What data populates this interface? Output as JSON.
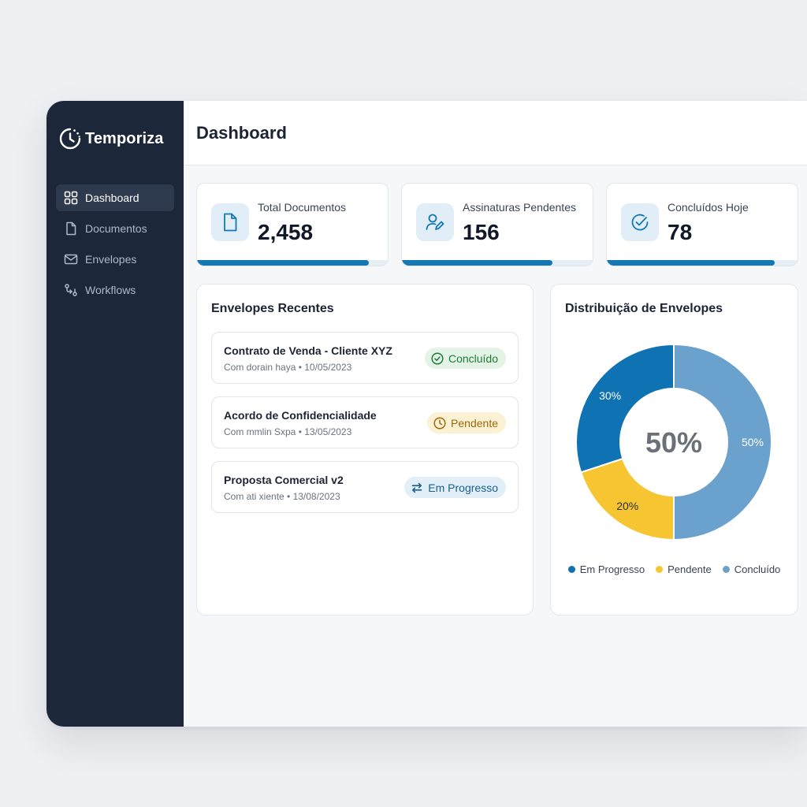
{
  "brand": {
    "name": "Temporiza"
  },
  "sidebar": {
    "items": [
      {
        "label": "Dashboard",
        "icon": "grid-icon",
        "active": true
      },
      {
        "label": "Documentos",
        "icon": "document-icon",
        "active": false
      },
      {
        "label": "Envelopes",
        "icon": "mail-icon",
        "active": false
      },
      {
        "label": "Workflows",
        "icon": "workflow-icon",
        "active": false
      }
    ]
  },
  "header": {
    "title": "Dashboard"
  },
  "stats": [
    {
      "label": "Total Documentos",
      "value": "2,458",
      "icon": "document-icon",
      "progress": 0.9
    },
    {
      "label": "Assinaturas Pendentes",
      "value": "156",
      "icon": "user-sign-icon",
      "progress": 0.79
    },
    {
      "label": "Concluídos Hoje",
      "value": "78",
      "icon": "check-circle-icon",
      "progress": 0.88
    }
  ],
  "recent": {
    "title": "Envelopes Recentes",
    "items": [
      {
        "name": "Contrato de Venda - Cliente XYZ",
        "meta": "Com dorain haya  •  10/05/2023",
        "status": "Concluído",
        "status_type": "done"
      },
      {
        "name": "Acordo de Confidencialidade",
        "meta": "Com mmlin Sxpa  •  13/05/2023",
        "status": "Pendente",
        "status_type": "pending"
      },
      {
        "name": "Proposta Comercial v2",
        "meta": "Com ati xiente  •  13/08/2023",
        "status": "Em Progresso",
        "status_type": "progress"
      }
    ]
  },
  "colors": {
    "em_progresso": "#0f72b2",
    "pendente": "#f6c531",
    "concluido": "#6aa1cd"
  },
  "chart_data": {
    "type": "pie",
    "title": "Distribuição de Envelopes",
    "center_label": "50%",
    "categories": [
      "Em Progresso",
      "Pendente",
      "Concluído"
    ],
    "values": [
      30,
      20,
      50
    ],
    "value_labels": [
      "30%",
      "20%",
      "50%"
    ],
    "legend": "bottom"
  }
}
